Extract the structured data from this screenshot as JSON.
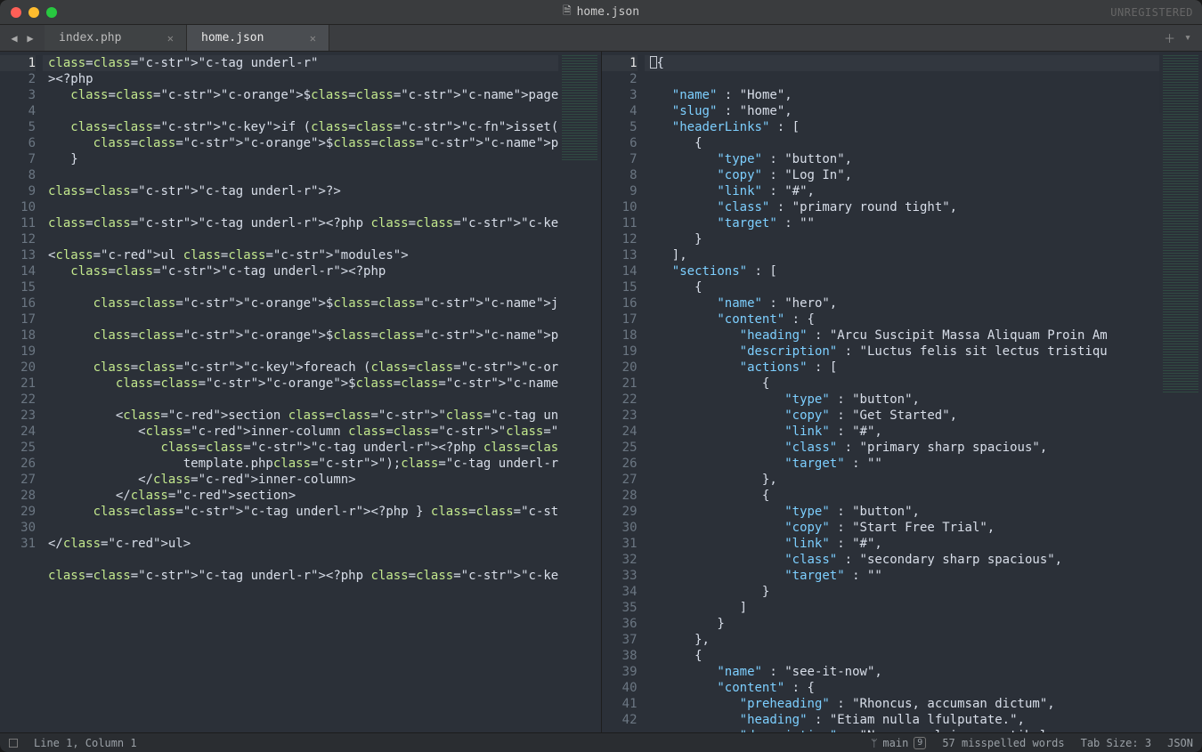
{
  "titlebar": {
    "title": "home.json",
    "unregistered": "UNREGISTERED"
  },
  "tabs": [
    {
      "label": "index.php",
      "active": false
    },
    {
      "label": "home.json",
      "active": true
    }
  ],
  "statusbar": {
    "position": "Line 1, Column 1",
    "branch": "main",
    "branch_count": "9",
    "spell": "57 misspelled words",
    "tab_size": "Tab Size: 3",
    "syntax": "JSON"
  },
  "left": {
    "lines": [
      1,
      2,
      3,
      4,
      5,
      6,
      7,
      8,
      9,
      10,
      11,
      12,
      13,
      14,
      15,
      16,
      17,
      18,
      19,
      20,
      21,
      22,
      23,
      24,
      25,
      26,
      27,
      28,
      29,
      30,
      31
    ],
    "code": [
      "<?php",
      "   $page = \"home\";",
      "",
      "   if (isset($_GET[\"page\"])) {",
      "      $page = $_GET[\"page\"];",
      "   }",
      "",
      "?>",
      "",
      "<?php include(\"header.php\");?>",
      "",
      "<ul class=\"modules\">",
      "   <?php",
      "",
      "      $json = file_get_contents(\"data/pages/$page.json\");",
      "",
      "      $pageData = json_decode($json, true);",
      "",
      "      foreach ($pageData['sections'] as $section) {",
      "         $columnWidth = $section['width'] ?? \"\"; ?>",
      "",
      "         <section class=\"<?=$section['name']?>\">",
      "            <inner-column class=\"<?=$columnWidth?>\">",
      "               <?php include(\"modules/$section[name]/",
      "                  template.php\");?>",
      "            </inner-column>",
      "         </section>",
      "      <?php } ?>",
      "",
      "</ul>",
      "",
      "<?php include(\"site-footer.php\");?>"
    ]
  },
  "right": {
    "lines": [
      1,
      2,
      3,
      4,
      5,
      6,
      7,
      8,
      9,
      10,
      11,
      12,
      13,
      14,
      15,
      16,
      17,
      18,
      19,
      20,
      21,
      22,
      23,
      24,
      25,
      26,
      27,
      28,
      29,
      30,
      31,
      32,
      33,
      34,
      35,
      36,
      37,
      38,
      39,
      40,
      41,
      42
    ],
    "code": [
      "{",
      "   \"name\" : \"Home\",",
      "   \"slug\" : \"home\",",
      "   \"headerLinks\" : [",
      "      {",
      "         \"type\" : \"button\",",
      "         \"copy\" : \"Log In\",",
      "         \"link\" : \"#\",",
      "         \"class\" : \"primary round tight\",",
      "         \"target\" : \"\"",
      "      }",
      "   ],",
      "   \"sections\" : [",
      "      {",
      "         \"name\" : \"hero\",",
      "         \"content\" : {",
      "            \"heading\" : \"Arcu Suscipit Massa Aliquam Proin Am",
      "            \"description\" : \"Luctus felis sit lectus tristiqu",
      "            \"actions\" : [",
      "               {",
      "                  \"type\" : \"button\",",
      "                  \"copy\" : \"Get Started\",",
      "                  \"link\" : \"#\",",
      "                  \"class\" : \"primary sharp spacious\",",
      "                  \"target\" : \"\"",
      "               },",
      "               {",
      "                  \"type\" : \"button\",",
      "                  \"copy\" : \"Start Free Trial\",",
      "                  \"link\" : \"#\",",
      "                  \"class\" : \"secondary sharp spacious\",",
      "                  \"target\" : \"\"",
      "               }",
      "            ]",
      "         }",
      "      },",
      "      {",
      "         \"name\" : \"see-it-now\",",
      "         \"content\" : {",
      "            \"preheading\" : \"Rhoncus, accumsan dictum\",",
      "            \"heading\" : \"Etiam nulla lfulputate.\",",
      "            \"description\" : \"Neque, pulvinar vestibulum non a"
    ]
  }
}
